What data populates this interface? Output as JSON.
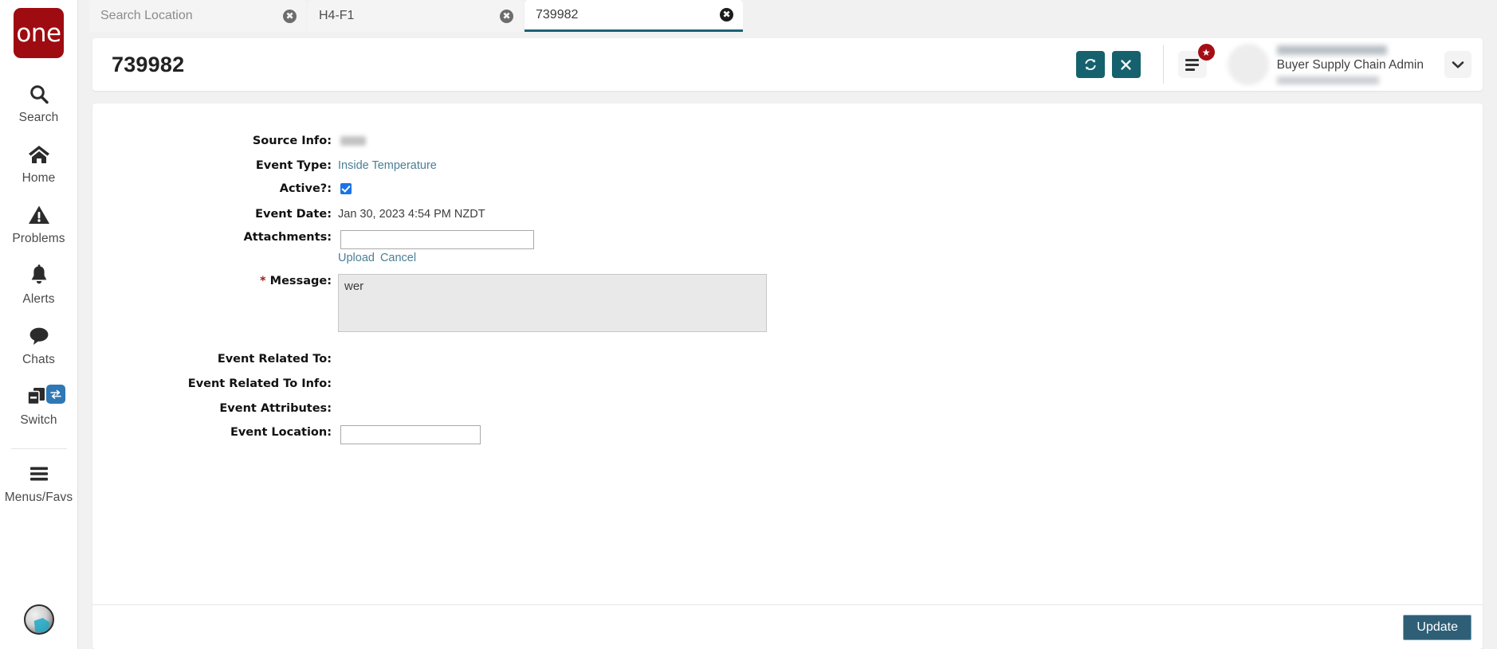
{
  "brand": {
    "logo_text": "one",
    "logo_color": "#9e0b10"
  },
  "theme": {
    "accent_teal": "#15616d",
    "footer_button": "#2e5f77",
    "link_blue": "#4a7f96",
    "badge_red": "#a50d14",
    "checkbox_blue": "#1a73e8"
  },
  "rail": {
    "items": [
      {
        "label": "Search",
        "icon": "search-icon"
      },
      {
        "label": "Home",
        "icon": "home-icon"
      },
      {
        "label": "Problems",
        "icon": "warning-triangle-icon"
      },
      {
        "label": "Alerts",
        "icon": "bell-icon"
      },
      {
        "label": "Chats",
        "icon": "chat-bubble-icon"
      },
      {
        "label": "Switch",
        "icon": "windows-stack-icon",
        "badge_icon": "swap-arrows-icon"
      },
      {
        "label": "Menus/Favs",
        "icon": "hamburger-icon"
      }
    ],
    "avatar_icon": "user-avatar-icon"
  },
  "search": {
    "fields": [
      {
        "value": "",
        "placeholder": "Search Location",
        "clear_icon": "clear-circle-icon",
        "active": false
      },
      {
        "value": "H4-F1",
        "placeholder": "",
        "clear_icon": "clear-circle-icon",
        "active": false
      },
      {
        "value": "739982",
        "placeholder": "",
        "clear_icon": "clear-circle-icon",
        "active": true
      }
    ]
  },
  "header": {
    "title": "739982",
    "refresh_icon": "refresh-icon",
    "close_icon": "close-x-icon",
    "menus_favs_icon": "hamburger-icon",
    "favorite_badge_icon": "star-icon",
    "user_role": "Buyer Supply Chain Admin",
    "dropdown_icon": "chevron-down-icon"
  },
  "form": {
    "source_info_label": "Source Info:",
    "source_info_value": "",
    "event_type_label": "Event Type:",
    "event_type_value": "Inside Temperature",
    "active_label": "Active?:",
    "active_checked": true,
    "event_date_label": "Event Date:",
    "event_date_value": "Jan 30, 2023 4:54 PM NZDT",
    "attachments_label": "Attachments:",
    "attachments_value": "",
    "upload_label": "Upload",
    "cancel_label": "Cancel",
    "message_required_marker": "*",
    "message_label": "Message:",
    "message_value": "wer",
    "event_related_to_label": "Event Related To:",
    "event_related_to_value": "",
    "event_related_to_info_label": "Event Related To Info:",
    "event_related_to_info_value": "",
    "event_attributes_label": "Event Attributes:",
    "event_attributes_value": "",
    "event_location_label": "Event Location:",
    "event_location_value": ""
  },
  "footer": {
    "update_label": "Update"
  }
}
